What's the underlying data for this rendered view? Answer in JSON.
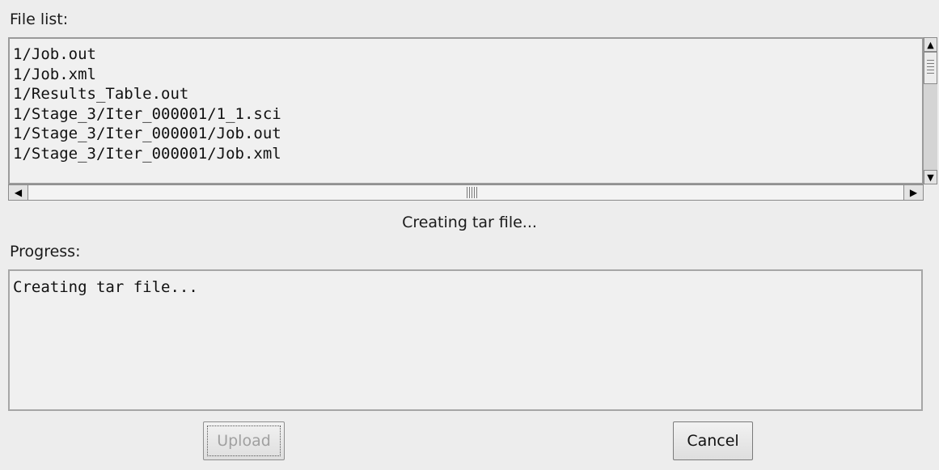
{
  "file_list": {
    "label": "File list:",
    "items": [
      "1/Job.out",
      "1/Job.xml",
      "1/Results_Table.out",
      "1/Stage_3/Iter_000001/1_1.sci",
      "1/Stage_3/Iter_000001/Job.out",
      "1/Stage_3/Iter_000001/Job.xml"
    ]
  },
  "status": {
    "text": "Creating tar file..."
  },
  "progress": {
    "label": "Progress:",
    "text": "Creating tar file..."
  },
  "buttons": {
    "upload_label": "Upload",
    "cancel_label": "Cancel"
  },
  "icons": {
    "scroll_up": "arrow-up-icon",
    "scroll_down": "arrow-down-icon",
    "scroll_left": "arrow-left-icon",
    "scroll_right": "arrow-right-icon"
  }
}
